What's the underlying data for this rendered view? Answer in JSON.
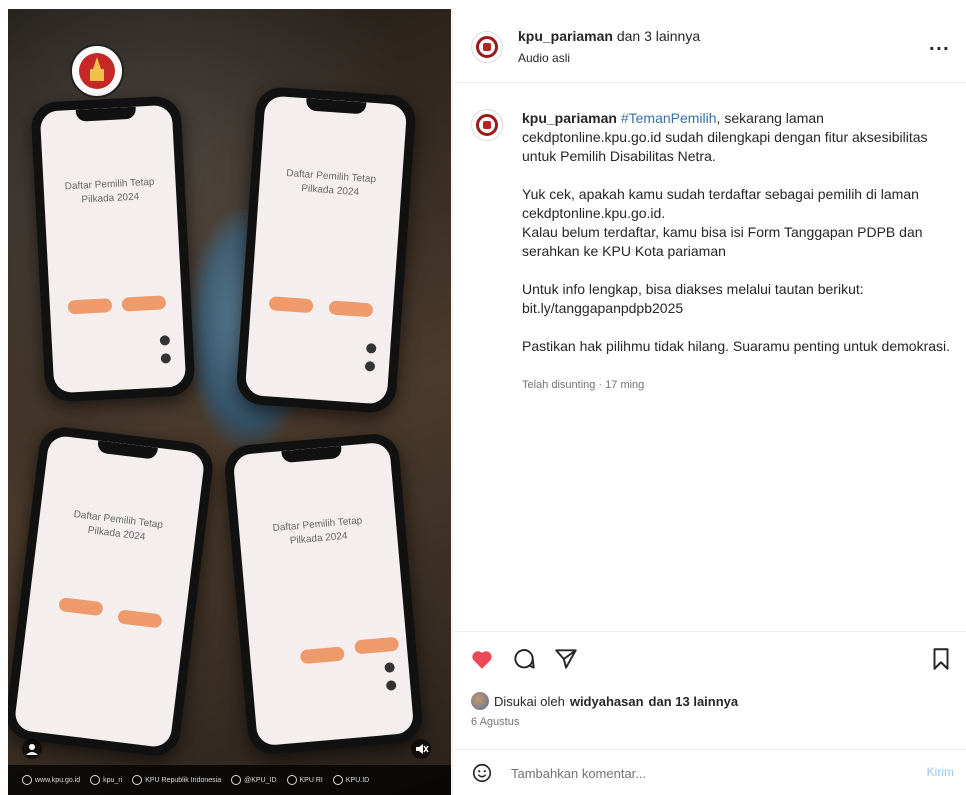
{
  "header": {
    "username": "kpu_pariaman",
    "coauthors": "dan 3 lainnya",
    "audio": "Audio asli",
    "more_label": "..."
  },
  "caption": {
    "username": "kpu_pariaman",
    "hashtag": "#TemanPemilih",
    "para1": ", sekarang laman cekdptonline.kpu.go.id sudah dilengkapi dengan fitur aksesibilitas untuk Pemilih Disabilitas Netra.",
    "para2_line1": "Yuk cek, apakah kamu sudah terdaftar sebagai pemilih di laman cekdptonline.kpu.go.id.",
    "para2_line2": "Kalau belum terdaftar, kamu bisa isi Form Tanggapan PDPB dan serahkan ke KPU Kota pariaman",
    "para3_line1": "Untuk info lengkap, bisa diakses melalui tautan berikut:",
    "para3_line2": "bit.ly/tanggapanpdpb2025",
    "para4": "Pastikan hak pilihmu tidak hilang. Suaramu penting untuk demokrasi.",
    "edited": "Telah disunting · 17 ming"
  },
  "actions": {
    "liked_by_prefix": "Disukai oleh",
    "liked_by_user": "widyahasan",
    "liked_by_suffix": "dan 13 lainnya",
    "date": "6 Agustus"
  },
  "comment": {
    "placeholder": "Tambahkan komentar...",
    "post_label": "Kirim"
  },
  "media": {
    "phone_title_1": "Daftar Pemilih Tetap Pilkada 2024",
    "phone_title_2": "Daftar Pemilih Tetap Pilkada 2024",
    "phone_title_3": "Daftar Pemilih Tetap Pilkada 2024",
    "phone_title_4": "Daftar Pemilih Tetap Pilkada 2024",
    "footer_items": [
      "www.kpu.go.id",
      "kpu_ri",
      "KPU Republik Indonesia",
      "@KPU_ID",
      "KPU RI",
      "KPU.ID"
    ]
  },
  "colors": {
    "heart": "#ed4956",
    "link": "#3a6ea5",
    "post_button": "#9cc7f0"
  }
}
